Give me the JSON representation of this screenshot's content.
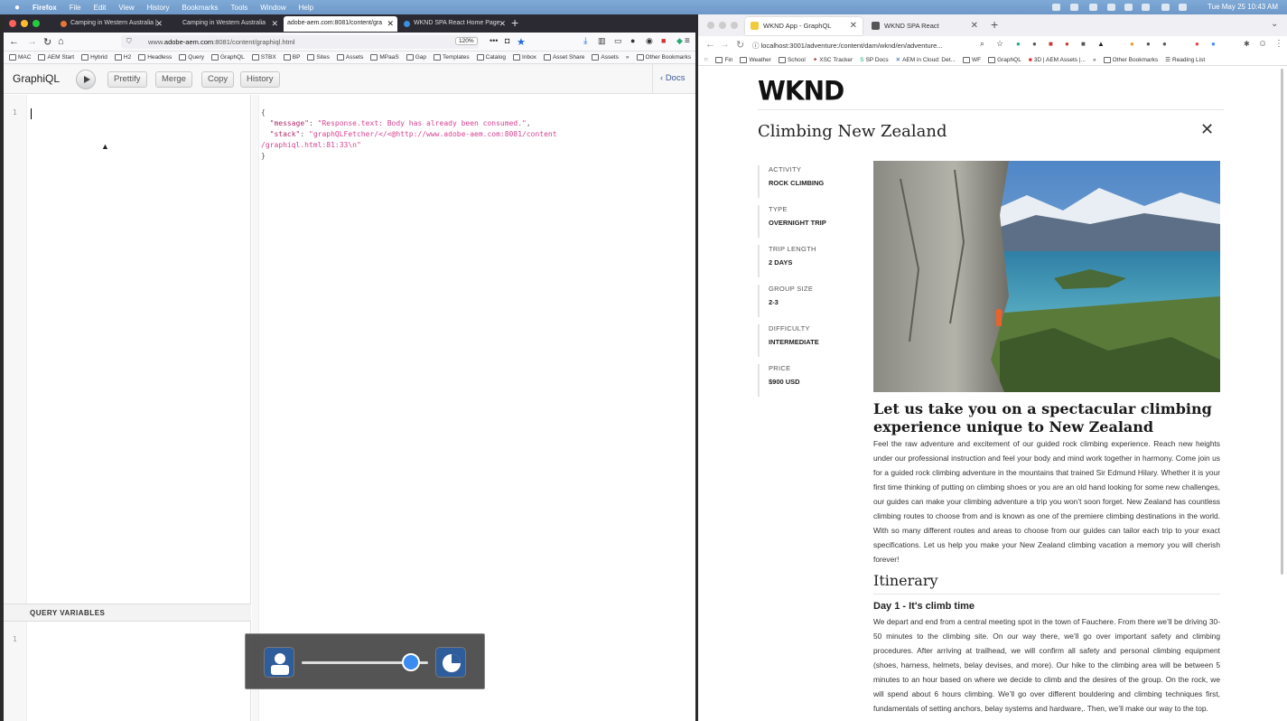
{
  "menubar": {
    "items": [
      "Firefox",
      "File",
      "Edit",
      "View",
      "History",
      "Bookmarks",
      "Tools",
      "Window",
      "Help"
    ],
    "clock": "Tue May 25  10:43 AM"
  },
  "left_browser": {
    "tabs": [
      {
        "label": "Camping in Western Australia |"
      },
      {
        "label": "Camping in Western Australia"
      },
      {
        "label": "adobe-aem.com:8081/content/gra"
      },
      {
        "label": "WKND SPA React Home Page"
      }
    ],
    "url_prefix": "www.",
    "url_domain": "adobe-aem.com",
    "url_rest": ":8081/content/graphiql.html",
    "zoom": "120%",
    "bookmarks": [
      "MAC",
      "AEM Start",
      "Hybrid",
      "H2",
      "Headless",
      "Query",
      "GraphQL",
      "STBX",
      "BP",
      "Sites",
      "Assets",
      "MPaaS",
      "Gap",
      "Templates",
      "Catalog",
      "Inbox",
      "Asset Share",
      "Assets"
    ],
    "other_bookmarks": "Other Bookmarks"
  },
  "graphiql": {
    "title": "GraphiQL",
    "prettify": "Prettify",
    "merge": "Merge",
    "copy": "Copy",
    "history": "History",
    "docs": "Docs",
    "line1": "1",
    "qv_line1": "1",
    "query_variables": "QUERY VARIABLES",
    "result": {
      "open": "{",
      "k1": "\"message\"",
      "v1": "\"Response.text: Body has already been consumed.\"",
      "k2": "\"stack\"",
      "v2": "\"graphQLFetcher/</<@http://www.adobe-aem.com:8081/content",
      "v2b": "/graphiql.html:81:33\\n\"",
      "close": "}"
    }
  },
  "right_browser": {
    "tabs": [
      {
        "label": "WKND App - GraphQL"
      },
      {
        "label": "WKND SPA React"
      }
    ],
    "url": "localhost:3001/adventure:/content/dam/wknd/en/adventure...",
    "bookmarks": [
      "Fin",
      "Weather",
      "School",
      "XSC Tracker",
      "SP Docs",
      "AEM in Cloud: Det...",
      "WF",
      "GraphQL",
      "3D | AEM Assets |..."
    ],
    "other_bookmarks": "Other Bookmarks",
    "reading_list": "Reading List"
  },
  "wknd": {
    "logo": "WKND",
    "title": "Climbing New Zealand",
    "attributes": [
      {
        "label": "ACTIVITY",
        "value": "ROCK CLIMBING"
      },
      {
        "label": "TYPE",
        "value": "OVERNIGHT TRIP"
      },
      {
        "label": "TRIP LENGTH",
        "value": "2 DAYS"
      },
      {
        "label": "GROUP SIZE",
        "value": "2-3"
      },
      {
        "label": "DIFFICULTY",
        "value": "INTERMEDIATE"
      },
      {
        "label": "PRICE",
        "value": "$900 USD"
      }
    ],
    "headline": "Let us take you on a spectacular climbing experience unique to New Zealand",
    "description": "Feel the raw adventure and excitement of our guided rock climbing experience. Reach new heights under our professional instruction and feel your body and mind work together in harmony. Come join us for a guided rock climbing adventure in the mountains that trained Sir Edmund Hilary. Whether it is your first time thinking of putting on climbing shoes or you are an old hand looking for some new challenges, our guides can make your climbing adventure a trip you won’t soon forget. New Zealand has countless climbing routes to choose from and is known as one of the premiere climbing destinations in the world. With so many different routes and areas to choose from our guides can tailor each trip to your exact specifications. Let us help you make your New Zealand climbing vacation a memory you will cherish forever!",
    "itinerary": "Itinerary",
    "day1_title": "Day 1 - It's climb time",
    "day1_text": "We depart and end from a central meeting spot in the town of Fauchere.  From there we’ll be driving 30-50 minutes to the climbing site. On our way there, we’ll go over important safety and climbing procedures. After arriving at trailhead, we will confirm all safety and personal climbing equipment (shoes, harness, helmets, belay devises, and more). Our hike to the climbing area will be between 5 minutes to an hour based on where we decide to climb and the desires of the group. On the rock, we will spend about 6 hours climbing.  We’ll go over different bouldering and climbing techniques first, fundamentals of setting anchors, belay systems and hardware,. Then, we’ll make our way to the top."
  }
}
